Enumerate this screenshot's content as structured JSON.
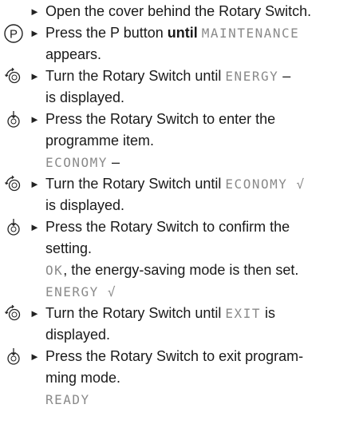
{
  "steps": {
    "s1": {
      "line1": "Open the cover behind the Rotary Switch."
    },
    "s2": {
      "icon": "p-button-icon",
      "line1_pre": "Press the P button ",
      "line1_bold": "until",
      "line1_disp": "MAINTENANCE",
      "line2": "appears."
    },
    "s3": {
      "icon": "rotary-turn-icon",
      "line1_pre": "Turn the Rotary Switch until ",
      "line1_disp": "ENERGY",
      "line1_post": " –",
      "line2": "is displayed."
    },
    "s4": {
      "icon": "rotary-press-icon",
      "line1": "Press the Rotary Switch to enter the",
      "line2": "programme item.",
      "line3_disp": "ECONOMY",
      "line3_post": " –"
    },
    "s5": {
      "icon": "rotary-turn-icon",
      "line1_pre": "Turn the Rotary Switch until ",
      "line1_disp": "ECONOMY",
      "line1_post": " √",
      "line2": "is displayed."
    },
    "s6": {
      "icon": "rotary-press-icon",
      "line1": "Press the Rotary Switch to confirm the",
      "line2": "setting.",
      "line3_disp": "OK",
      "line3_post": ", the energy-saving mode is then set.",
      "line4_disp": "ENERGY",
      "line4_post": " √"
    },
    "s7": {
      "icon": "rotary-turn-icon",
      "line1_pre": "Turn the Rotary Switch until ",
      "line1_disp": "EXIT",
      "line1_post": " is",
      "line2": "displayed."
    },
    "s8": {
      "icon": "rotary-press-icon",
      "line1": "Press the Rotary Switch to exit program-",
      "line2": "ming mode.",
      "line3_disp": "READY"
    }
  },
  "bullet_glyph": "►"
}
